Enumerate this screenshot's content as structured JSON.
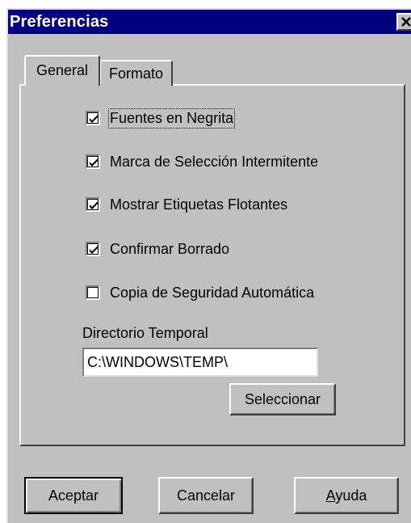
{
  "window": {
    "title": "Preferencias",
    "close_glyph": "✕"
  },
  "tabs": [
    {
      "label": "General",
      "active": true
    },
    {
      "label": "Formato",
      "active": false
    }
  ],
  "options": [
    {
      "label": "Fuentes en Negrita",
      "checked": true
    },
    {
      "label": "Marca de Selección Intermitente",
      "checked": true
    },
    {
      "label": "Mostrar Etiquetas Flotantes",
      "checked": true
    },
    {
      "label": "Confirmar Borrado",
      "checked": true
    },
    {
      "label": "Copia de Seguridad Automática",
      "checked": false
    }
  ],
  "temp_dir": {
    "label": "Directorio Temporal",
    "value": "C:\\WINDOWS\\TEMP\\",
    "select_button": "Seleccionar"
  },
  "buttons": {
    "accept": "Aceptar",
    "cancel": "Cancelar",
    "help_first": "A",
    "help_rest": "yuda"
  },
  "colors": {
    "titlebar": "#000080",
    "face": "#c0c0c0"
  }
}
